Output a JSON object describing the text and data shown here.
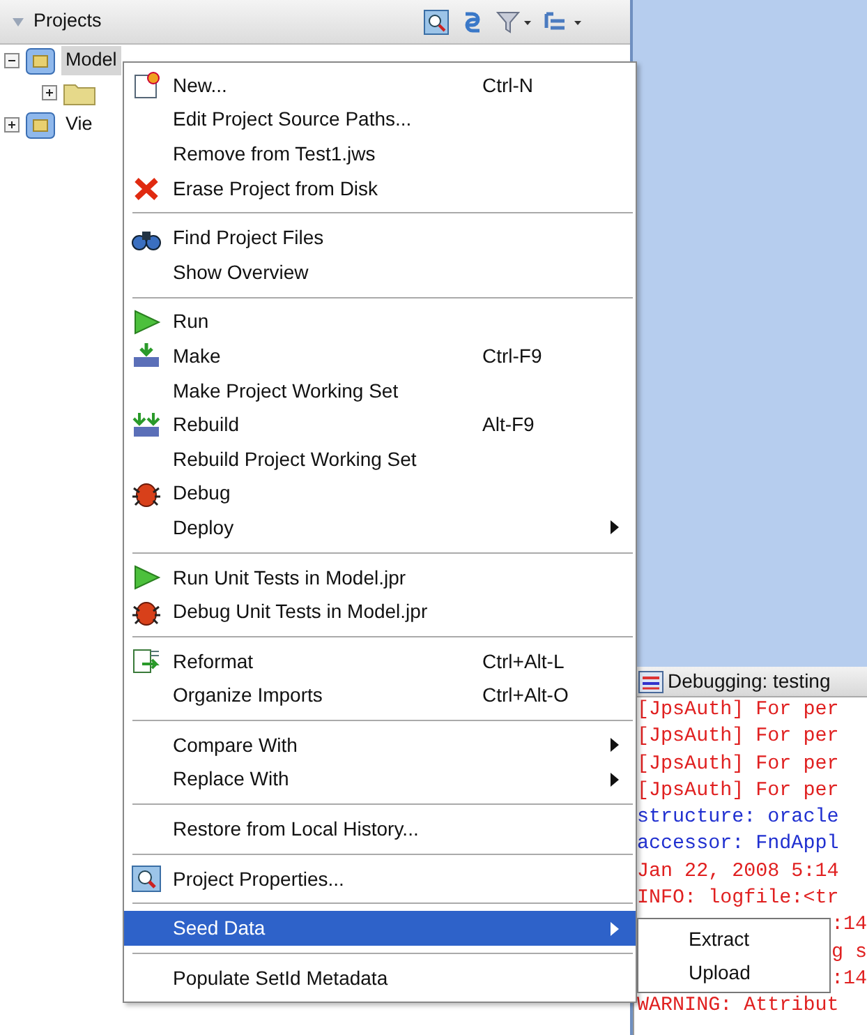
{
  "projects_panel": {
    "title": "Projects",
    "tree": [
      {
        "label": "Model",
        "expanded": true,
        "selected": true,
        "children": [
          {
            "expanded": false,
            "selected": false
          }
        ]
      },
      {
        "label": "Vie",
        "expanded": false,
        "selected": false
      }
    ]
  },
  "context_menu": [
    {
      "kind": "item",
      "label": "New...",
      "shortcut": "Ctrl-N",
      "selected": false
    },
    {
      "kind": "item",
      "label": "Edit Project Source Paths...",
      "selected": false
    },
    {
      "kind": "item",
      "label": "Remove from Test1.jws",
      "selected": false
    },
    {
      "kind": "item",
      "label": "Erase Project from Disk",
      "selected": false
    },
    {
      "kind": "separator"
    },
    {
      "kind": "item",
      "label": "Find Project Files",
      "selected": false
    },
    {
      "kind": "item",
      "label": "Show Overview",
      "selected": false
    },
    {
      "kind": "separator"
    },
    {
      "kind": "item",
      "label": "Run",
      "selected": false
    },
    {
      "kind": "item",
      "label": "Make",
      "shortcut": "Ctrl-F9",
      "selected": false
    },
    {
      "kind": "item",
      "label": "Make Project Working Set",
      "selected": false
    },
    {
      "kind": "item",
      "label": "Rebuild",
      "shortcut": "Alt-F9",
      "selected": false
    },
    {
      "kind": "item",
      "label": "Rebuild Project Working Set",
      "selected": false
    },
    {
      "kind": "item",
      "label": "Debug",
      "selected": false
    },
    {
      "kind": "submenu",
      "label": "Deploy",
      "selected": false
    },
    {
      "kind": "separator"
    },
    {
      "kind": "item",
      "label": "Run Unit Tests in Model.jpr",
      "selected": false
    },
    {
      "kind": "item",
      "label": "Debug Unit Tests in Model.jpr",
      "selected": false
    },
    {
      "kind": "separator"
    },
    {
      "kind": "item",
      "label": "Reformat",
      "shortcut": "Ctrl+Alt-L",
      "selected": false
    },
    {
      "kind": "item",
      "label": "Organize Imports",
      "shortcut": "Ctrl+Alt-O",
      "selected": false
    },
    {
      "kind": "separator"
    },
    {
      "kind": "submenu",
      "label": "Compare With",
      "selected": false
    },
    {
      "kind": "submenu",
      "label": "Replace With",
      "selected": false
    },
    {
      "kind": "separator"
    },
    {
      "kind": "item",
      "label": "Restore from Local History...",
      "selected": false
    },
    {
      "kind": "separator"
    },
    {
      "kind": "item",
      "label": "Project Properties...",
      "selected": false
    },
    {
      "kind": "separator"
    },
    {
      "kind": "submenu",
      "label": "Seed Data",
      "selected": true
    },
    {
      "kind": "separator"
    },
    {
      "kind": "item",
      "label": "Populate SetId Metadata",
      "selected": false
    }
  ],
  "submenu": [
    {
      "label": "Extract"
    },
    {
      "label": "Upload"
    }
  ],
  "log_panel": {
    "title": "Debugging: testing",
    "lines": [
      {
        "kind": "full",
        "text": "[JpsAuth] For per",
        "color": "#e02020"
      },
      {
        "kind": "full",
        "text": "[JpsAuth] For per",
        "color": "#e02020"
      },
      {
        "kind": "full",
        "text": "[JpsAuth] For per",
        "color": "#e02020"
      },
      {
        "kind": "full",
        "text": "[JpsAuth] For per",
        "color": "#e02020"
      },
      {
        "kind": "full",
        "text": "structure: oracle",
        "color": "#2030d0"
      },
      {
        "kind": "full",
        "text": "accessor: FndAppl",
        "color": "#2030d0"
      },
      {
        "kind": "full",
        "text": "Jan 22, 2008 5:14",
        "color": "#e02020"
      },
      {
        "kind": "full",
        "text": "INFO: logfile:<tr",
        "color": "#e02020"
      },
      {
        "kind": "covered",
        "text": ":14",
        "color": "#e02020"
      },
      {
        "kind": "covered",
        "text": "g s",
        "color": "#e02020"
      },
      {
        "kind": "covered",
        "text": ":14",
        "color": "#e02020"
      },
      {
        "kind": "full",
        "text": "WARNING: Attribut",
        "color": "#e02020"
      }
    ]
  }
}
